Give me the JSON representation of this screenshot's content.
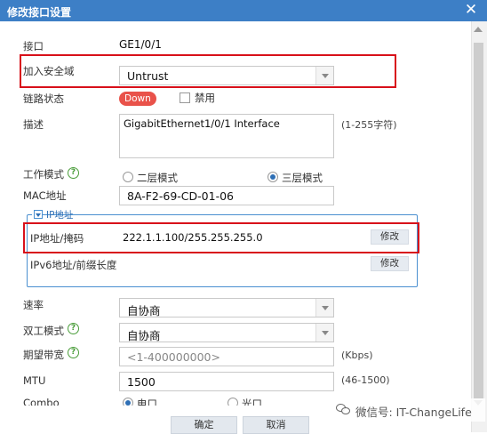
{
  "dialog": {
    "title": "修改接口设置"
  },
  "interface": {
    "label": "接口",
    "value": "GE1/0/1"
  },
  "security_zone": {
    "label": "加入安全域",
    "value": "Untrust"
  },
  "link_status": {
    "label": "链路状态",
    "badge": "Down",
    "disable_label": "禁用"
  },
  "description": {
    "label": "描述",
    "value": "GigabitEthernet1/0/1 Interface",
    "hint": "(1-255字符)"
  },
  "work_mode": {
    "label": "工作模式",
    "option_l2": "二层模式",
    "option_l3": "三层模式",
    "selected": "三层模式"
  },
  "mac": {
    "label": "MAC地址",
    "value": "8A-F2-69-CD-01-06"
  },
  "ip_section": {
    "legend": "IP地址",
    "ipv4_label": "IP地址/掩码",
    "ipv4_value": "222.1.1.100/255.255.255.0",
    "ipv4_button": "修改",
    "ipv6_label": "IPv6地址/前缀长度",
    "ipv6_button": "修改"
  },
  "speed": {
    "label": "速率",
    "value": "自协商"
  },
  "duplex": {
    "label": "双工模式",
    "value": "自协商"
  },
  "bandwidth": {
    "label": "期望带宽",
    "placeholder": "<1-400000000>",
    "hint": "(Kbps)"
  },
  "mtu": {
    "label": "MTU",
    "value": "1500",
    "hint": "(46-1500)"
  },
  "combo": {
    "label": "Combo",
    "option_copper": "电口",
    "option_fiber": "光口",
    "selected": "电口"
  },
  "footer": {
    "ok_label": "确定",
    "cancel_label": "取消"
  },
  "watermark": {
    "text": "微信号: IT-ChangeLife"
  },
  "colors": {
    "titlebar": "#3d7fc6",
    "highlight": "#d8101a",
    "badge": "#e9524a",
    "section_border": "#4a8fd0"
  }
}
